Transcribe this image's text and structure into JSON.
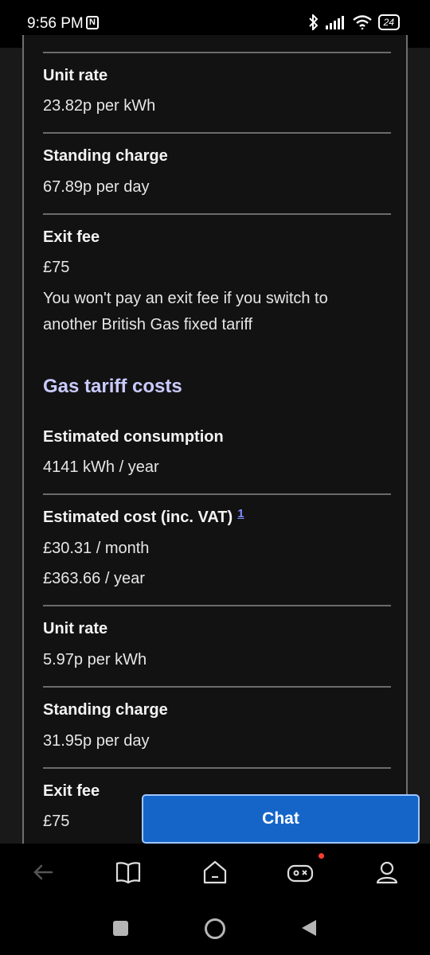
{
  "status_bar": {
    "time": "9:56 PM",
    "battery": "24"
  },
  "electricity": {
    "unit_rate_label": "Unit rate",
    "unit_rate_value": "23.82p per kWh",
    "standing_charge_label": "Standing charge",
    "standing_charge_value": "67.89p per day",
    "exit_fee_label": "Exit fee",
    "exit_fee_value": "£75",
    "exit_fee_note_line1": "You won't pay an exit fee if you switch to",
    "exit_fee_note_line2": "another British Gas fixed tariff"
  },
  "gas": {
    "heading": "Gas tariff costs",
    "consumption_label": "Estimated consumption",
    "consumption_value": "4141 kWh / year",
    "cost_label": "Estimated cost (inc. VAT)",
    "cost_footnote": "1",
    "cost_month": "£30.31 / month",
    "cost_year": "£363.66 / year",
    "unit_rate_label": "Unit rate",
    "unit_rate_value": "5.97p per kWh",
    "standing_charge_label": "Standing charge",
    "standing_charge_value": "31.95p per day",
    "exit_fee_label": "Exit fee",
    "exit_fee_value": "£75"
  },
  "chat_button": {
    "label": "Chat"
  },
  "icons": {
    "app_nav": [
      "back-arrow-icon",
      "book-icon",
      "home-icon",
      "gamepad-icon",
      "profile-icon"
    ],
    "system_nav": [
      "recents-icon",
      "home-circle-icon",
      "back-triangle-icon"
    ]
  },
  "colors": {
    "accent_heading": "#c9cbff",
    "chat_button": "#1565c9",
    "notification_dot": "#ff3b30"
  }
}
